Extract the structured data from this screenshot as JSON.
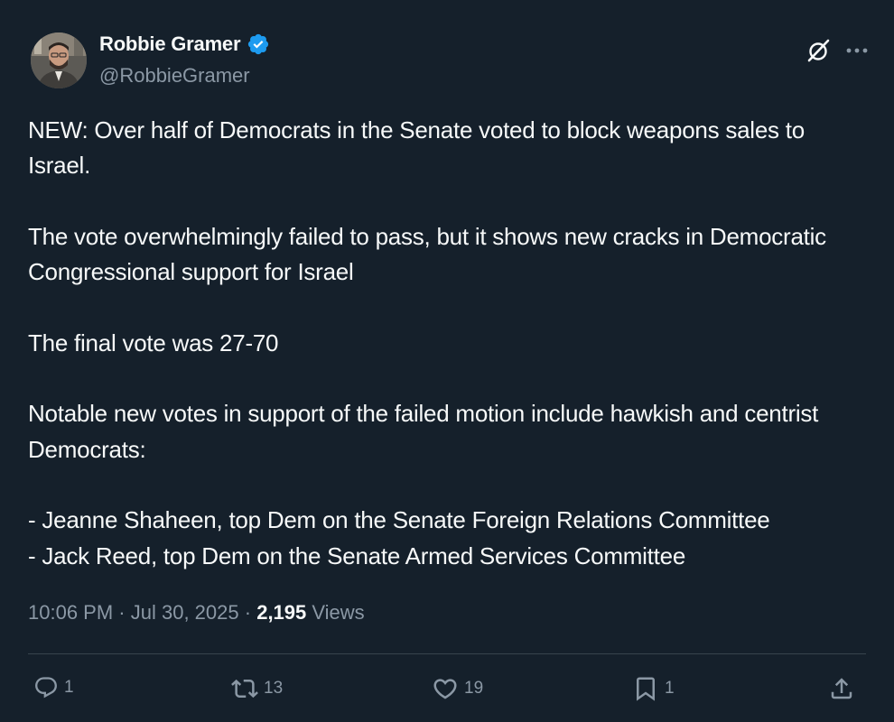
{
  "author": {
    "display_name": "Robbie Gramer",
    "handle": "@RobbieGramer"
  },
  "icons": {
    "verified": "verified-badge-icon",
    "grok": "grok-icon",
    "more": "more-options-icon",
    "reply": "reply-icon",
    "repost": "repost-icon",
    "like": "like-icon",
    "bookmark": "bookmark-icon",
    "share": "share-icon"
  },
  "colors": {
    "background": "#15202b",
    "text": "#f7f9f9",
    "secondary_text": "#8b98a5",
    "verified_blue": "#1d9bf0",
    "divider": "#38444d"
  },
  "tweet": {
    "text": "NEW: Over half of Democrats in the Senate voted to block weapons sales to Israel.\n\nThe vote overwhelmingly failed to pass, but it shows new cracks in Democratic Congressional support for Israel\n\nThe final vote was 27-70\n\nNotable new votes in support of the failed motion include hawkish and centrist Democrats:\n\n- Jeanne Shaheen, top Dem on the Senate Foreign Relations Committee\n- Jack Reed, top Dem on the Senate Armed Services Committee",
    "time": "10:06 PM",
    "separator": "·",
    "date": "Jul 30, 2025",
    "views_count": "2,195",
    "views_label": "Views"
  },
  "actions": {
    "replies": "1",
    "reposts": "13",
    "likes": "19",
    "bookmarks": "1"
  }
}
